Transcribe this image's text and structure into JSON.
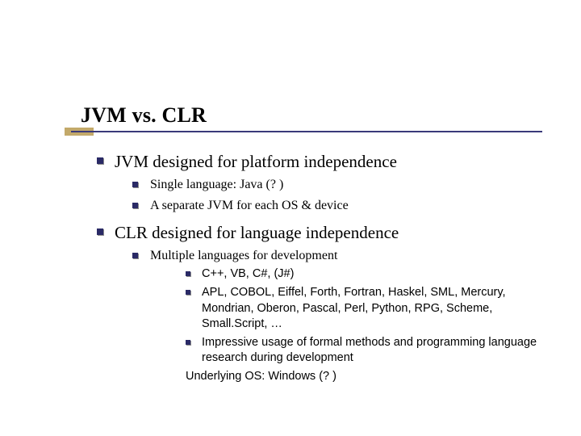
{
  "title": "JVM vs. CLR",
  "points": [
    {
      "text": "JVM designed for platform independence",
      "sub": [
        {
          "text": "Single language: Java (? )"
        },
        {
          "text": "A separate JVM for each OS & device"
        }
      ]
    },
    {
      "text": "CLR designed for language independence",
      "sub": [
        {
          "text": "Multiple languages for development",
          "sub": [
            {
              "text": "C++, VB, C#, (J#)"
            },
            {
              "text": "APL, COBOL, Eiffel, Forth, Fortran, Haskel, SML, Mercury, Mondrian, Oberon, Pascal, Perl, Python, RPG, Scheme, Small.Script, …"
            },
            {
              "text": "Impressive usage of formal methods and programming language research during development"
            }
          ],
          "trail": "Underlying OS: Windows (? )"
        }
      ]
    }
  ]
}
